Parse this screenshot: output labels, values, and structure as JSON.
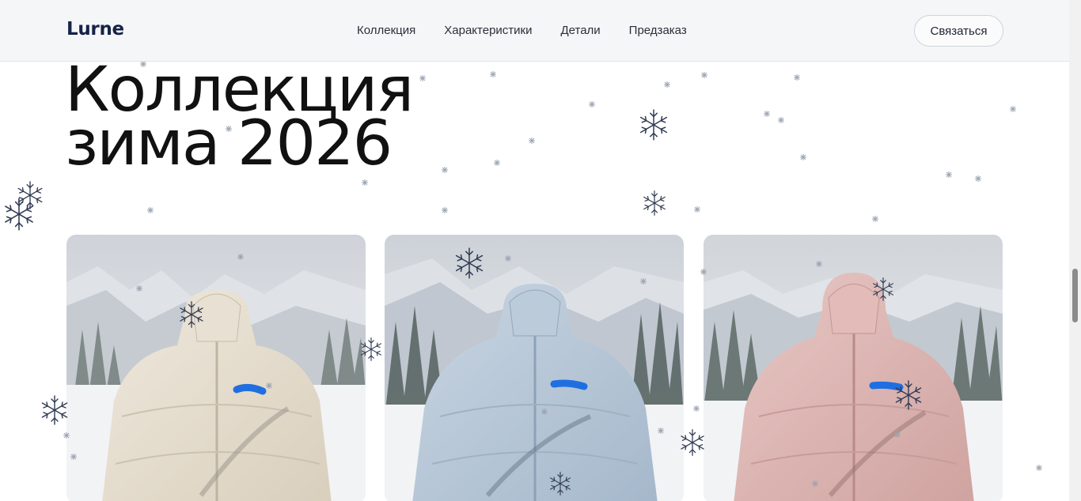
{
  "header": {
    "logo": "Lurne",
    "nav": [
      "Коллекция",
      "Характеристики",
      "Детали",
      "Предзаказ"
    ],
    "cta_label": "Связаться"
  },
  "hero": {
    "title_line1": "Коллекция",
    "title_line2": "зима 2026"
  },
  "products": [
    {
      "name": "beige-jacket",
      "color": "#e6ddcc"
    },
    {
      "name": "blue-jacket",
      "color": "#b9cad9"
    },
    {
      "name": "pink-jacket",
      "color": "#dcb6b3"
    }
  ],
  "icons": {
    "snowflake": "snowflake-icon"
  },
  "colors": {
    "brand": "#172347",
    "accent_mark": "#1f6fe0",
    "header_bg": "#f5f6f8"
  }
}
